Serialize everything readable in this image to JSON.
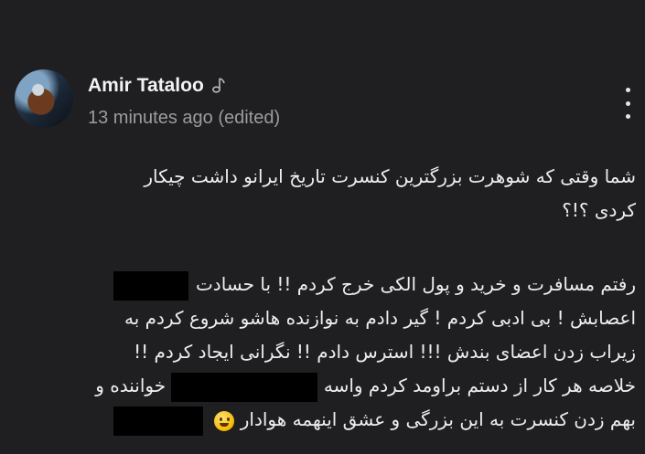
{
  "comment": {
    "author": "Amir Tataloo",
    "author_badge_icon": "music-note-icon",
    "timestamp": "13 minutes ago (edited)",
    "more_icon": "more-vert-icon",
    "text_color": "#eeeeee",
    "background": "#1f1f21",
    "paragraph1": [
      "شما وقتی که شوهرت بزرگترین کنسرت تاریخ ایرانو داشت چیکار",
      "کردی ؟!؟"
    ],
    "paragraph2": {
      "line1_text": "رفتم مسافرت و خرید و پول الکی خرج کردم  !! با حسادت",
      "line2_text": "اعصابش ! بی ادبی کردم ! گیر دادم به نوازنده هاشو شروع کردم به",
      "line3_text": "زیراب زدن اعضای بندش !!! استرس دادم !! نگرانی ایجاد کردم !!",
      "line4_before": "خلاصه هر کار از دستم براومد کردم واسه",
      "line4_after": "خواننده و",
      "line5_text": "بهم زدن کنسرت به این بزرگی و عشق اینهمه هوادار",
      "line5_emoji": "smiling-face-emoji"
    }
  }
}
